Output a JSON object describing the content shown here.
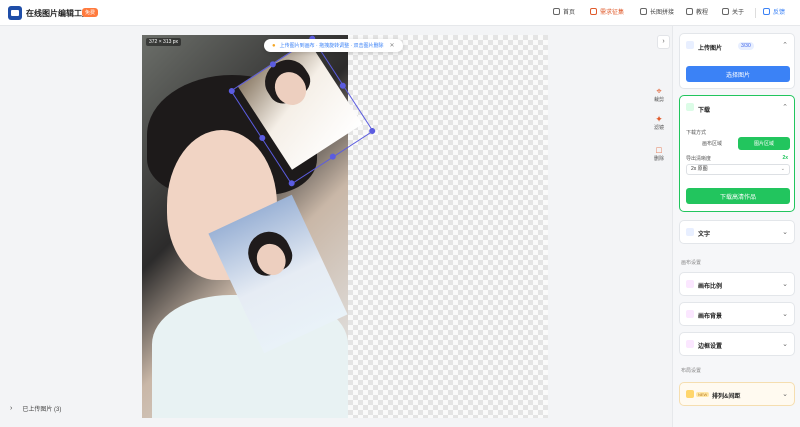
{
  "header": {
    "app_title": "在线图片编辑工具",
    "free_badge": "免费",
    "nav": [
      {
        "label": "首页",
        "icon": "home-icon"
      },
      {
        "label": "需求征集",
        "icon": "heart-icon",
        "active": true
      },
      {
        "label": "长图拼接",
        "icon": "image-icon"
      },
      {
        "label": "教程",
        "icon": "book-icon"
      },
      {
        "label": "关于",
        "icon": "info-icon"
      },
      {
        "label": "反馈",
        "icon": "chat-icon"
      }
    ]
  },
  "canvas": {
    "size_badge": "372 × 313 px"
  },
  "toast": {
    "text": "上传图片到画布 · 拖拽旋转调整 · 双击图片删除"
  },
  "tools": [
    {
      "label": "裁剪",
      "icon": "crop-icon"
    },
    {
      "label": "滤镜",
      "icon": "magic-icon"
    },
    {
      "label": "删除",
      "icon": "trash-icon"
    }
  ],
  "panel": {
    "upload": {
      "title": "上传图片",
      "count": "3/30",
      "button": "选择图片"
    },
    "download": {
      "title": "下载",
      "mode_label": "下载方式",
      "mode_options": [
        "画布区域",
        "图片区域"
      ],
      "export_label": "导出清晰度",
      "export_multiplier": "2x",
      "export_value": "2x 原图",
      "button": "下载高清作品"
    },
    "text_card": {
      "title": "文字"
    },
    "canvas_section_label": "画布设置",
    "canvas_ratio": {
      "title": "画布比例"
    },
    "canvas_bg": {
      "title": "画布背景"
    },
    "border": {
      "title": "边框设置"
    },
    "more_section_label": "布局设置",
    "arrange": {
      "title": "排列&间距",
      "tag": "NEW"
    }
  },
  "bottom": {
    "uploaded_label": "已上传图片 (3)"
  },
  "colors": {
    "accent_blue": "#3b82f6",
    "accent_green": "#22c55e",
    "accent_orange": "#e05a2b",
    "selection": "#5b5ce0"
  }
}
